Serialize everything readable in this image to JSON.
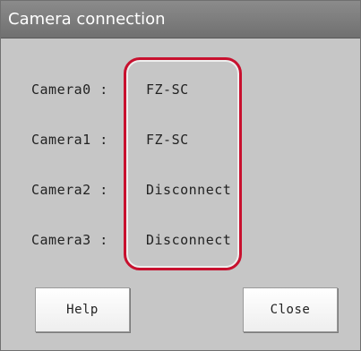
{
  "window": {
    "title": "Camera connection"
  },
  "cameras": [
    {
      "label": "Camera0 :",
      "value": "FZ-SC"
    },
    {
      "label": "Camera1 :",
      "value": "FZ-SC"
    },
    {
      "label": "Camera2 :",
      "value": "Disconnect"
    },
    {
      "label": "Camera3 :",
      "value": "Disconnect"
    }
  ],
  "buttons": {
    "help_label": "Help",
    "close_label": "Close"
  },
  "colors": {
    "titlebar": "#7d7d7d",
    "panel": "#c6c6c6",
    "highlight": "#c8102e"
  }
}
